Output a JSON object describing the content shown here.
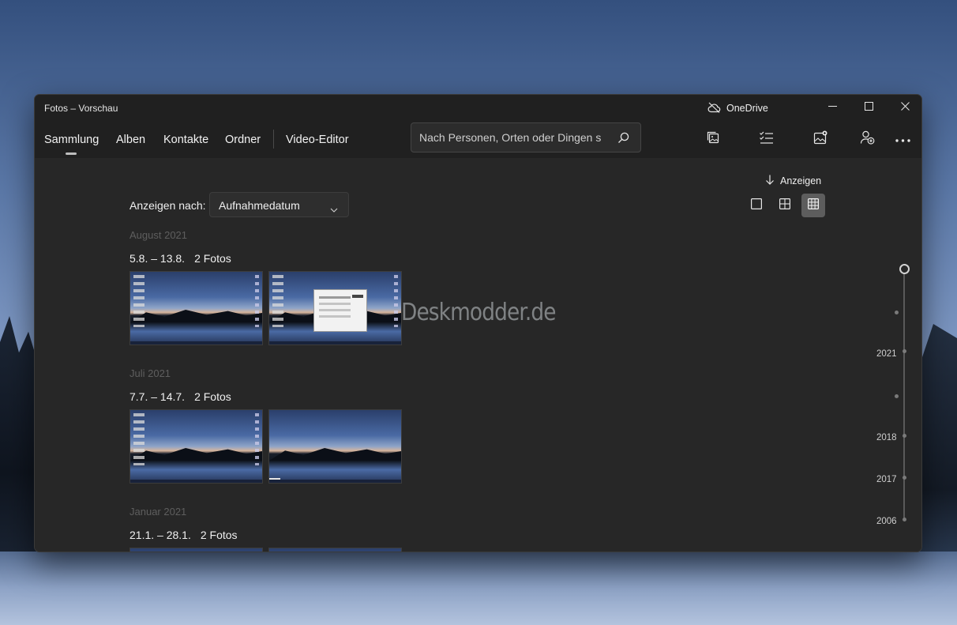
{
  "window": {
    "title": "Fotos – Vorschau",
    "onedrive_label": "OneDrive"
  },
  "nav": {
    "tabs": [
      {
        "label": "Sammlung",
        "active": true
      },
      {
        "label": "Alben"
      },
      {
        "label": "Kontakte"
      },
      {
        "label": "Ordner"
      },
      {
        "label": "Video-Editor"
      }
    ]
  },
  "search": {
    "placeholder": "Nach Personen, Orten oder Dingen su"
  },
  "toolbar": {
    "icons": [
      "photo-stack-icon",
      "select-list-icon",
      "image-import-icon",
      "person-add-icon",
      "more-icon"
    ]
  },
  "view": {
    "sort_label": "Anzeigen",
    "view_by_label": "Anzeigen nach:",
    "view_by_value": "Aufnahmedatum",
    "size_options": [
      "single",
      "medium-grid",
      "small-grid"
    ],
    "selected_size": "small-grid"
  },
  "groups": [
    {
      "month": "August 2021",
      "range": "5.8. – 13.8.",
      "count": "2 Fotos"
    },
    {
      "month": "Juli 2021",
      "range": "7.7. – 14.7.",
      "count": "2 Fotos"
    },
    {
      "month": "Januar 2021",
      "range": "21.1. – 28.1.",
      "count": "2 Fotos"
    }
  ],
  "watermark": "Deskmodder.de",
  "timeline": {
    "years": [
      "2021",
      "2018",
      "2017",
      "2006"
    ]
  },
  "colors": {
    "window_bg": "#272727",
    "titlebar_bg": "#202020",
    "selected_view_bg": "#5d5d5d",
    "month_label": "#5e5e5e"
  }
}
